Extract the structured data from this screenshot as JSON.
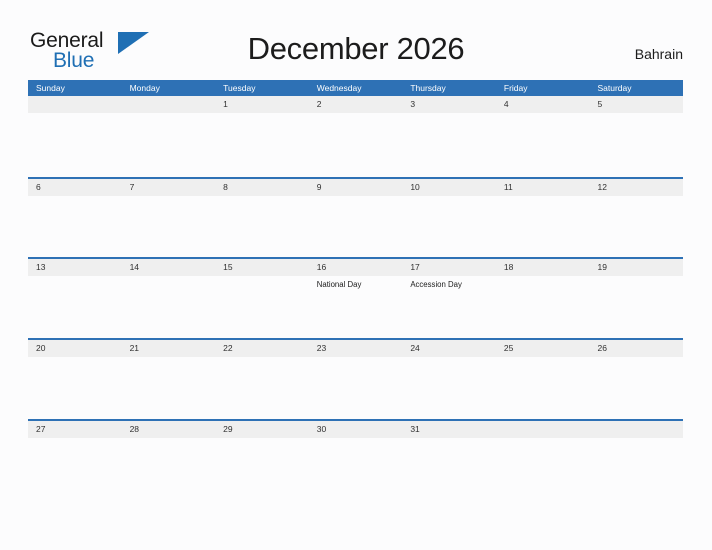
{
  "brand": {
    "name_part1": "General",
    "name_part2": "Blue",
    "flag_icon": "blue-flag-triangle-icon",
    "color_primary": "#1f6fb4",
    "color_text": "#1a1a1a"
  },
  "header": {
    "title": "December 2026",
    "country": "Bahrain"
  },
  "theme": {
    "header_bg": "#2e71b5",
    "row_band_bg": "#efefef",
    "row_divider": "#2e71b5",
    "page_bg": "#fcfcfd",
    "text": "#303030"
  },
  "calendar": {
    "month": "December",
    "year": "2026",
    "weekdays": [
      "Sunday",
      "Monday",
      "Tuesday",
      "Wednesday",
      "Thursday",
      "Friday",
      "Saturday"
    ],
    "weeks": [
      [
        {
          "day": "",
          "events": []
        },
        {
          "day": "",
          "events": []
        },
        {
          "day": "1",
          "events": []
        },
        {
          "day": "2",
          "events": []
        },
        {
          "day": "3",
          "events": []
        },
        {
          "day": "4",
          "events": []
        },
        {
          "day": "5",
          "events": []
        }
      ],
      [
        {
          "day": "6",
          "events": []
        },
        {
          "day": "7",
          "events": []
        },
        {
          "day": "8",
          "events": []
        },
        {
          "day": "9",
          "events": []
        },
        {
          "day": "10",
          "events": []
        },
        {
          "day": "11",
          "events": []
        },
        {
          "day": "12",
          "events": []
        }
      ],
      [
        {
          "day": "13",
          "events": []
        },
        {
          "day": "14",
          "events": []
        },
        {
          "day": "15",
          "events": []
        },
        {
          "day": "16",
          "events": [
            "National Day"
          ]
        },
        {
          "day": "17",
          "events": [
            "Accession Day"
          ]
        },
        {
          "day": "18",
          "events": []
        },
        {
          "day": "19",
          "events": []
        }
      ],
      [
        {
          "day": "20",
          "events": []
        },
        {
          "day": "21",
          "events": []
        },
        {
          "day": "22",
          "events": []
        },
        {
          "day": "23",
          "events": []
        },
        {
          "day": "24",
          "events": []
        },
        {
          "day": "25",
          "events": []
        },
        {
          "day": "26",
          "events": []
        }
      ],
      [
        {
          "day": "27",
          "events": []
        },
        {
          "day": "28",
          "events": []
        },
        {
          "day": "29",
          "events": []
        },
        {
          "day": "30",
          "events": []
        },
        {
          "day": "31",
          "events": []
        },
        {
          "day": "",
          "events": []
        },
        {
          "day": "",
          "events": []
        }
      ]
    ]
  }
}
